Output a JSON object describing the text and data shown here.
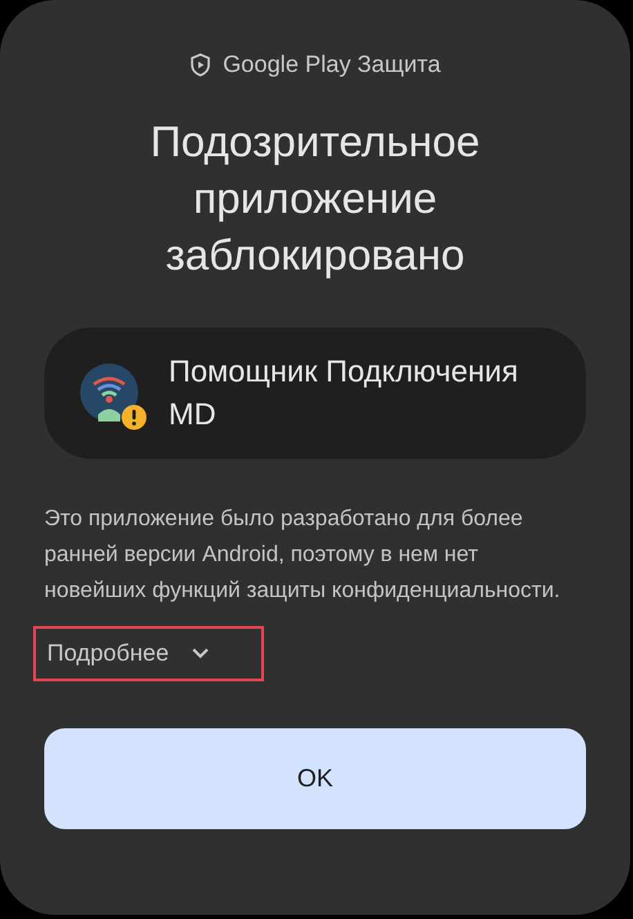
{
  "header": {
    "label": "Google Play Защита"
  },
  "title": "Подозрительное приложение заблокировано",
  "app": {
    "name": "Помощник Подключения MD",
    "warning": true
  },
  "description": "Это приложение было разработано для более ранней версии Android, поэтому в нем нет новейших функций защиты конфиденциальности.",
  "details_link": {
    "label": "Подробнее",
    "expanded": false,
    "highlighted": true
  },
  "buttons": [
    "OK"
  ]
}
